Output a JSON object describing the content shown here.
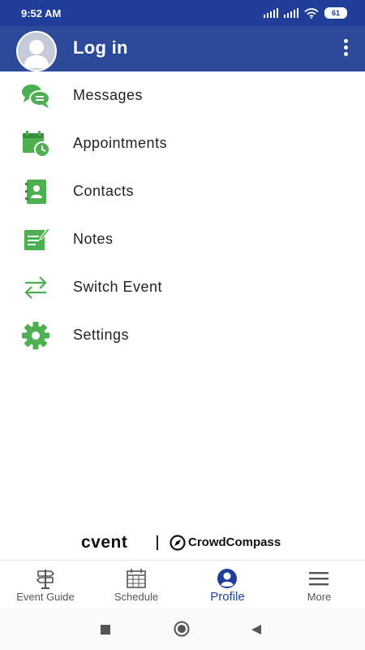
{
  "status_bar": {
    "time": "9:52 AM",
    "battery": "61"
  },
  "app_bar": {
    "title": "Log in"
  },
  "menu": {
    "items": [
      {
        "label": "Messages",
        "icon": "messages-icon"
      },
      {
        "label": "Appointments",
        "icon": "calendar-clock-icon"
      },
      {
        "label": "Contacts",
        "icon": "contacts-book-icon"
      },
      {
        "label": "Notes",
        "icon": "notes-icon"
      },
      {
        "label": "Switch Event",
        "icon": "switch-arrows-icon"
      },
      {
        "label": "Settings",
        "icon": "gear-icon"
      }
    ]
  },
  "branding": {
    "cvent": "cvent",
    "crowdcompass": "CrowdCompass"
  },
  "bottom_nav": {
    "items": [
      {
        "label": "Event Guide",
        "icon": "signpost-icon"
      },
      {
        "label": "Schedule",
        "icon": "calendar-icon"
      },
      {
        "label": "Profile",
        "icon": "profile-icon",
        "active": true
      },
      {
        "label": "More",
        "icon": "hamburger-icon"
      }
    ]
  },
  "colors": {
    "primary": "#2d4a9a",
    "status_bar": "#1f3e9a",
    "icon_green": "#4caf50",
    "active_nav": "#1f3e9a"
  }
}
